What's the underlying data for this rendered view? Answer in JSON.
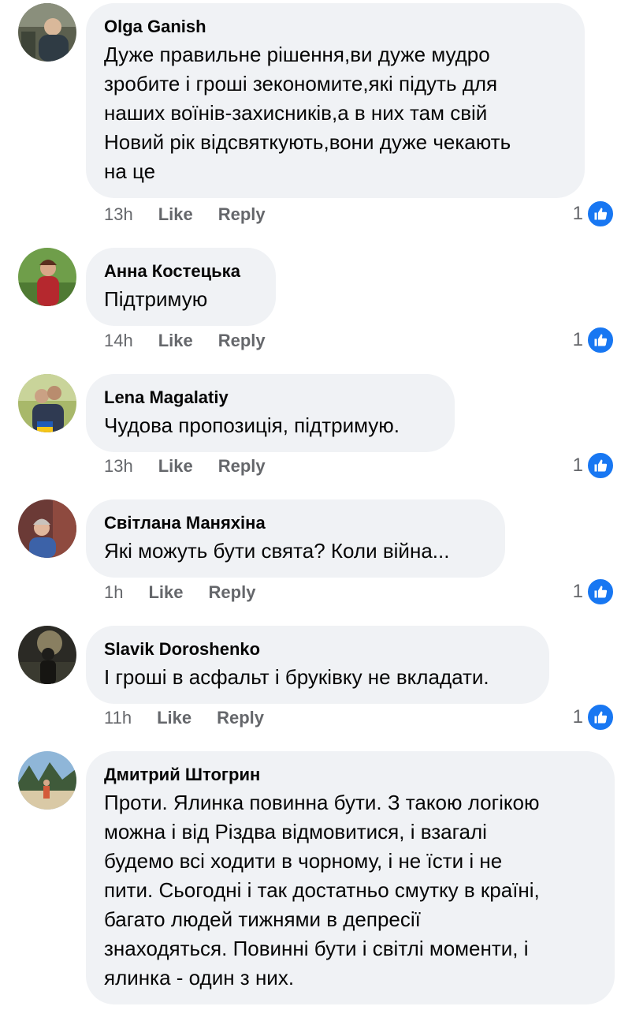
{
  "comments": [
    {
      "author": "Olga Ganish",
      "text": "Дуже правильне рішення,ви  дуже мудро\nзробите і гроші зекономите,які підуть для\nнаших воїнів-захисників,а в них там свій\nНовий рік  відсвяткують,вони дуже чекають\nна це",
      "time": "13h",
      "like_label": "Like",
      "reply_label": "Reply",
      "reactions": "1"
    },
    {
      "author": "Анна Костецька",
      "text": "Підтримую",
      "time": "14h",
      "like_label": "Like",
      "reply_label": "Reply",
      "reactions": "1"
    },
    {
      "author": "Lena Magalatiy",
      "text": "Чудова пропозиція, підтримую.",
      "time": "13h",
      "like_label": "Like",
      "reply_label": "Reply",
      "reactions": "1"
    },
    {
      "author": "Світлана Маняхіна",
      "text": "Які можуть бути свята? Коли війна...",
      "time": "1h",
      "like_label": "Like",
      "reply_label": "Reply",
      "reactions": "1"
    },
    {
      "author": "Slavik Doroshenko",
      "text": "І гроші в асфальт і бруківку не вкладати.",
      "time": "11h",
      "like_label": "Like",
      "reply_label": "Reply",
      "reactions": "1"
    },
    {
      "author": "Дмитрий Штогрин",
      "text": "Проти. Ялинка повинна бути. З такою логікою\nможна і від Різдва відмовитися, і взагалі\nбудемо всі ходити в чорному, і не їсти і не\nпити. Сьогодні і так достатньо смутку в країні,\nбагато людей тижнями в депресії\nзнаходяться. Повинні бути і світлі моменти, і\nялинка - один з них."
    }
  ],
  "colors": {
    "bubble": "#f0f2f5",
    "meta_text": "#65676b",
    "like_blue": "#1877f2"
  },
  "icons": {
    "reaction": "thumbs-up-icon"
  }
}
